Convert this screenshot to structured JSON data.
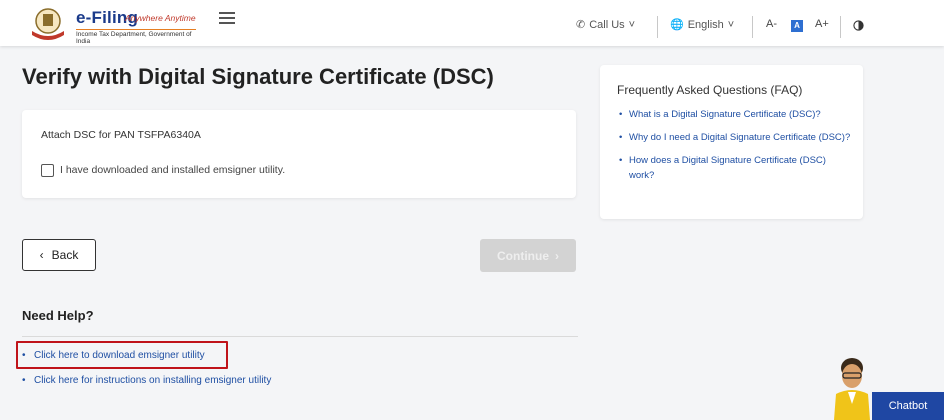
{
  "header": {
    "logo_title": "e-Filing",
    "logo_tagline": "Anywhere Anytime",
    "logo_subtitle": "Income Tax Department, Government of India",
    "call_us": "Call Us",
    "language": "English",
    "font_decrease": "A-",
    "font_normal": "A",
    "font_increase": "A+"
  },
  "main": {
    "title": "Verify with Digital Signature Certificate (DSC)",
    "attach_label": "Attach DSC for PAN TSFPA6340A",
    "checkbox_label": "I have downloaded and installed emsigner utility.",
    "back_label": "Back",
    "continue_label": "Continue"
  },
  "faq": {
    "title": "Frequently Asked Questions (FAQ)",
    "items": [
      "What is a Digital Signature Certificate (DSC)?",
      "Why do I need a Digital Signature Certificate (DSC)?",
      "How does a Digital Signature Certificate (DSC) work?"
    ]
  },
  "help": {
    "title": "Need Help?",
    "links": [
      "Click here to download emsigner utility",
      "Click here for instructions on installing emsigner utility"
    ]
  },
  "chatbot": {
    "label": "Chatbot"
  },
  "colors": {
    "brand_blue": "#1a3a8a",
    "link_blue": "#1f4fa3",
    "highlight_red": "#c0141a",
    "disabled_gray": "#d3d3d3"
  }
}
